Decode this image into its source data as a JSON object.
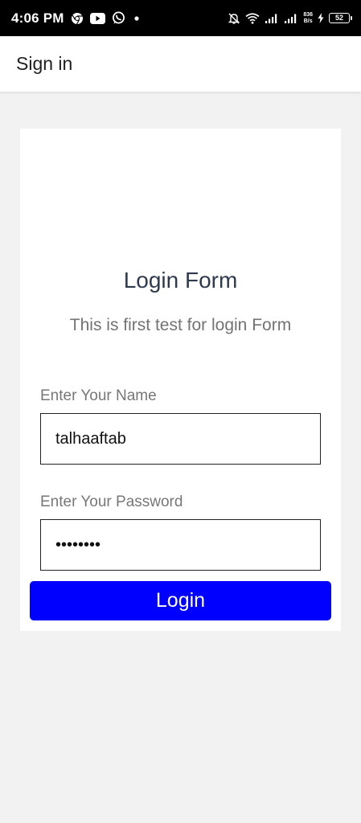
{
  "status_bar": {
    "time": "4:06 PM",
    "icons_left": [
      "chrome-icon",
      "youtube-icon",
      "whatsapp-icon",
      "dot-icon"
    ],
    "net_speed_value": "836",
    "net_speed_unit": "B/s",
    "battery": "52"
  },
  "app_bar": {
    "title": "Sign in"
  },
  "form": {
    "title": "Login Form",
    "subtitle": "This is first test for login Form",
    "name_label": "Enter Your Name",
    "name_value": "talhaaftab",
    "password_label": "Enter Your Password",
    "password_value": "••••••••",
    "login_label": "Login"
  },
  "colors": {
    "button": "#0000ff",
    "background": "#f2f2f2",
    "title": "#2f3a4d"
  }
}
